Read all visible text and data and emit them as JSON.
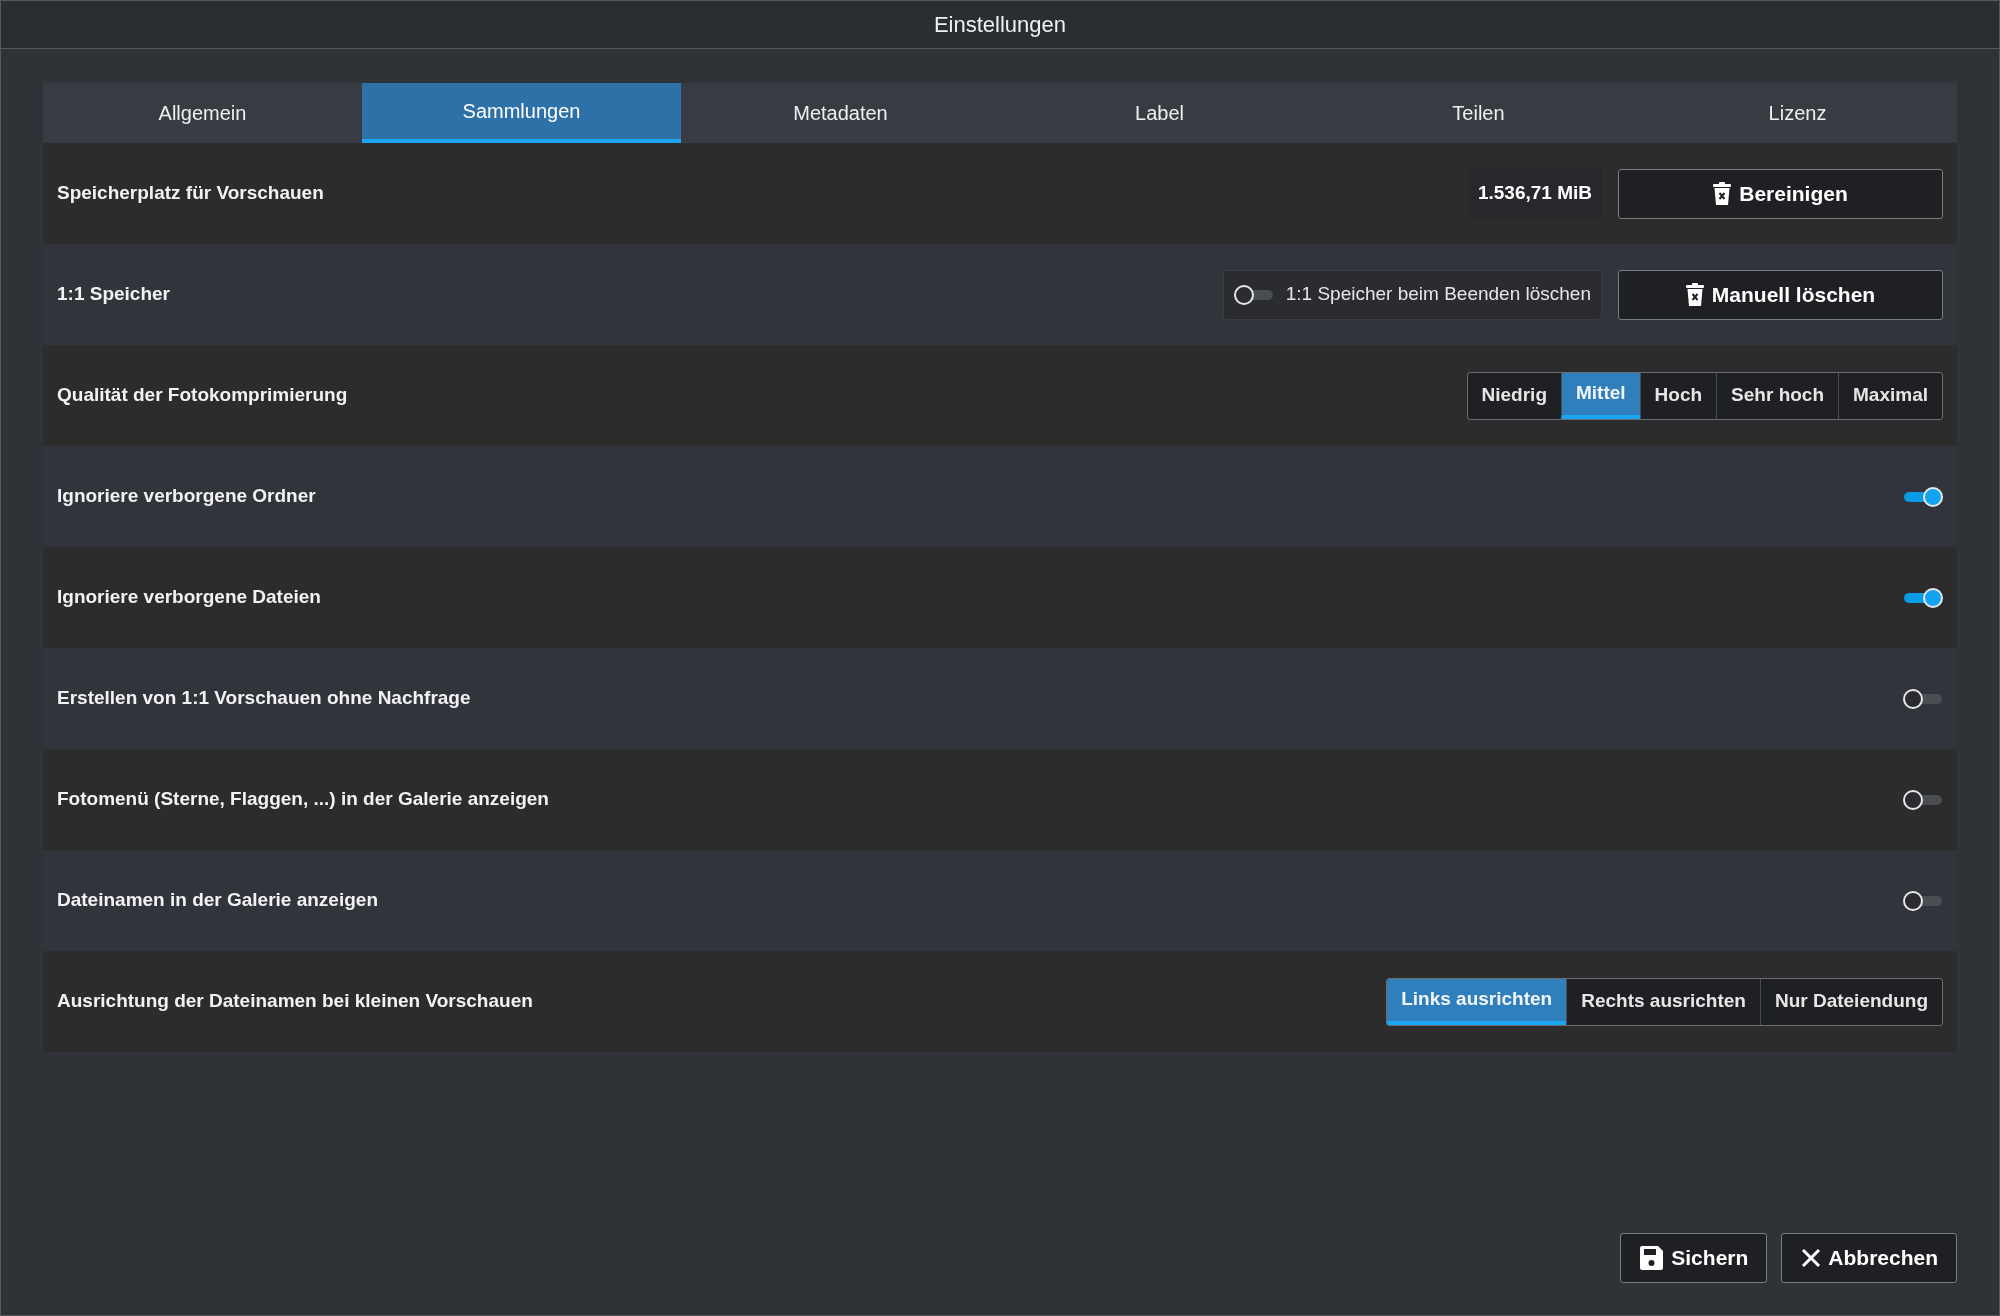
{
  "window": {
    "title": "Einstellungen"
  },
  "tabs": [
    {
      "label": "Allgemein",
      "selected": false
    },
    {
      "label": "Sammlungen",
      "selected": true
    },
    {
      "label": "Metadaten",
      "selected": false
    },
    {
      "label": "Label",
      "selected": false
    },
    {
      "label": "Teilen",
      "selected": false
    },
    {
      "label": "Lizenz",
      "selected": false
    }
  ],
  "rows": [
    {
      "kind": "storage",
      "label": "Speicherplatz für Vorschauen",
      "value": "1.536,71 MiB",
      "button": "Bereinigen"
    },
    {
      "kind": "cache",
      "label": "1:1 Speicher",
      "toggle": {
        "label": "1:1 Speicher beim Beenden löschen",
        "on": false
      },
      "button": "Manuell löschen"
    },
    {
      "kind": "choice",
      "label": "Qualität der Fotokomprimierung",
      "options": [
        {
          "label": "Niedrig",
          "selected": false
        },
        {
          "label": "Mittel",
          "selected": true
        },
        {
          "label": "Hoch",
          "selected": false
        },
        {
          "label": "Sehr hoch",
          "selected": false
        },
        {
          "label": "Maximal",
          "selected": false
        }
      ]
    },
    {
      "kind": "toggle",
      "label": "Ignoriere verborgene Ordner",
      "on": true
    },
    {
      "kind": "toggle",
      "label": "Ignoriere verborgene Dateien",
      "on": true
    },
    {
      "kind": "toggle",
      "label": "Erstellen von 1:1 Vorschauen ohne Nachfrage",
      "on": false
    },
    {
      "kind": "toggle",
      "label": "Fotomenü (Sterne, Flaggen, ...) in der Galerie anzeigen",
      "on": false
    },
    {
      "kind": "toggle",
      "label": "Dateinamen in der Galerie anzeigen",
      "on": false
    },
    {
      "kind": "choice",
      "label": "Ausrichtung der Dateinamen bei kleinen Vorschauen",
      "options": [
        {
          "label": "Links ausrichten",
          "selected": true
        },
        {
          "label": "Rechts ausrichten",
          "selected": false
        },
        {
          "label": "Nur Dateiendung",
          "selected": false
        }
      ]
    }
  ],
  "footer": [
    {
      "kind": "save",
      "label": "Sichern"
    },
    {
      "kind": "cancel",
      "label": "Abbrechen"
    }
  ]
}
